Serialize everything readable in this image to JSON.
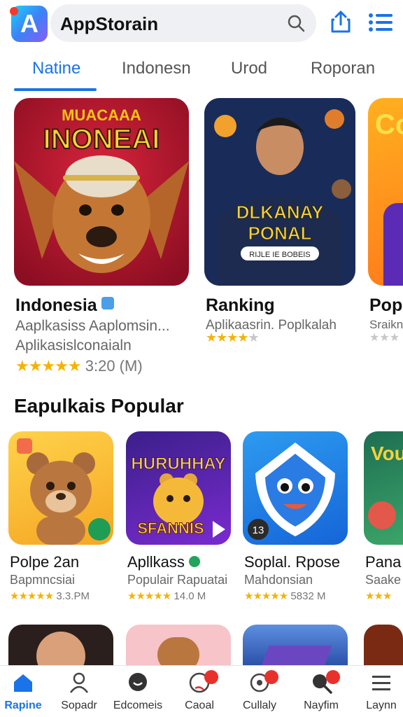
{
  "header": {
    "app_title": "AppStorain",
    "logo_letter": "A",
    "icons": {
      "search": "search-icon",
      "share": "share-icon",
      "menu": "list-menu-icon"
    }
  },
  "tabs": [
    {
      "label": "Natine",
      "active": true
    },
    {
      "label": "Indonesn",
      "active": false
    },
    {
      "label": "Urod",
      "active": false
    },
    {
      "label": "Roporan",
      "active": false
    }
  ],
  "featured": [
    {
      "art_title_top": "MUACAAA",
      "art_title": "INONEAI",
      "name": "Indonesia",
      "verified": true,
      "subtitle": "Aaplkasiss Aaplomsin...",
      "subtitle2": "Aplikasislconaialn",
      "rating_stars": 4.5,
      "meta": "3:20 (M)"
    },
    {
      "art_title": "DLKANAY PONAL",
      "art_caption": "RIJLE IE BOBEIS",
      "name": "Ranking",
      "verified": false,
      "subtitle": "Aplikaasrin. Poplkalah",
      "rating_stars": 4.5
    },
    {
      "art_title": "Co",
      "name": "Popl",
      "verified": false,
      "subtitle": "Sraikn",
      "rating_stars": 1.5
    }
  ],
  "section": {
    "title": "Eapulkais Popular"
  },
  "popular": [
    {
      "name": "Polpe 2an",
      "subtitle": "Bapmncsiai",
      "rating": "3.3.PM",
      "rating_stars": 4.5
    },
    {
      "art_title": "HURUHHAY",
      "art_caption": "SFANNIS",
      "name": "Apllkass",
      "verified": true,
      "subtitle": "Populair Rapuatai",
      "rating": "14.0 M",
      "rating_stars": 4.5
    },
    {
      "badge": "13",
      "name": "Soplal. Rpose",
      "subtitle": "Mahdonsian",
      "rating": "5832 M",
      "rating_stars": 4.5
    },
    {
      "art_title": "Vou",
      "name": "Pana",
      "subtitle": "Saake",
      "rating_stars": 3
    }
  ],
  "bottom_nav": [
    {
      "label": "Rapine",
      "icon": "home-icon",
      "active": true
    },
    {
      "label": "Sopadr",
      "icon": "person-icon",
      "active": false
    },
    {
      "label": "Edcomeis",
      "icon": "chat-icon",
      "active": false
    },
    {
      "label": "Caoal",
      "icon": "help-icon",
      "active": false,
      "badge": true
    },
    {
      "label": "Cullaly",
      "icon": "search-circle-icon",
      "active": false,
      "badge": true
    },
    {
      "label": "Nayfim",
      "icon": "magnifier-icon",
      "active": false,
      "badge": true
    },
    {
      "label": "Laynn",
      "icon": "hamburger-icon",
      "active": false
    }
  ],
  "colors": {
    "accent": "#1a73e8",
    "star": "#f5b301",
    "badge": "#e8312a"
  }
}
